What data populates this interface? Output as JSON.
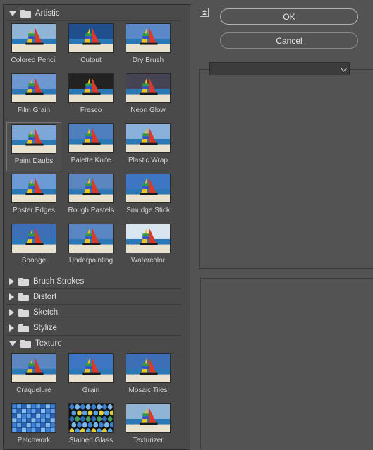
{
  "gallery": {
    "categories": [
      {
        "name": "Artistic",
        "expanded": true,
        "filters": [
          "Colored Pencil",
          "Cutout",
          "Dry Brush",
          "Film Grain",
          "Fresco",
          "Neon Glow",
          "Paint Daubs",
          "Palette Knife",
          "Plastic Wrap",
          "Poster Edges",
          "Rough Pastels",
          "Smudge Stick",
          "Sponge",
          "Underpainting",
          "Watercolor"
        ],
        "selected": "Paint Daubs"
      },
      {
        "name": "Brush Strokes",
        "expanded": false
      },
      {
        "name": "Distort",
        "expanded": false
      },
      {
        "name": "Sketch",
        "expanded": false
      },
      {
        "name": "Stylize",
        "expanded": false
      },
      {
        "name": "Texture",
        "expanded": true,
        "filters": [
          "Craquelure",
          "Grain",
          "Mosaic Tiles",
          "Patchwork",
          "Stained Glass",
          "Texturizer"
        ]
      }
    ]
  },
  "buttons": {
    "ok": "OK",
    "cancel": "Cancel"
  },
  "filter_select": {
    "value": ""
  },
  "icons": {
    "collapse": "collapse-up-icon",
    "folder": "folder-icon",
    "expand": "triangle-down-icon",
    "collapsed": "triangle-right-icon"
  }
}
